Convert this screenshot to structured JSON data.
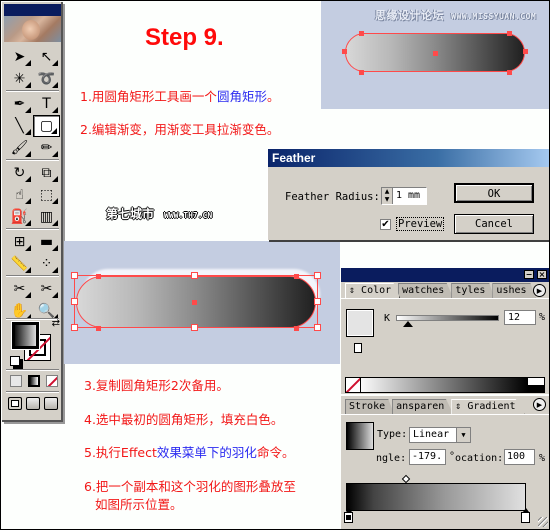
{
  "title": "Step 9.",
  "instructions": {
    "line1": {
      "prefix": "1.用圆角矩形工具画一个",
      "highlight": "圆角矩形",
      "suffix": "。"
    },
    "line2": "2.编辑渐变，用渐变工具拉渐变色。",
    "line3": "3.复制圆角矩形2次备用。",
    "line4": "4.选中最初的圆角矩形，填充白色。",
    "line5": {
      "prefix": "5.执行Effect",
      "highlight1": "效果菜单下的",
      "highlight2": "羽化",
      "suffix": "命令。"
    },
    "line6a": "6.把一个副本和这个羽化的图形叠放至",
    "line6b": "如图所示位置。"
  },
  "watermarks": {
    "missyuan_cn": "思缘设计论坛",
    "missyuan_url": "WWW.MISSYUAN.COM",
    "th7_cn": "第七城市",
    "th7_url": "WWW.TH7.CN"
  },
  "toolbox": {
    "tools": [
      {
        "name": "selection",
        "glyph": "➤"
      },
      {
        "name": "direct-selection",
        "glyph": "↖"
      },
      {
        "name": "magic-wand",
        "glyph": "✳"
      },
      {
        "name": "lasso",
        "glyph": "➰"
      },
      {
        "name": "pen",
        "glyph": "✒"
      },
      {
        "name": "type",
        "glyph": "T"
      },
      {
        "name": "line-segment",
        "glyph": "╲"
      },
      {
        "name": "rounded-rectangle",
        "glyph": "▢",
        "selected": true
      },
      {
        "name": "paintbrush",
        "glyph": "🖌"
      },
      {
        "name": "pencil",
        "glyph": "✏"
      },
      {
        "name": "rotate",
        "glyph": "↻"
      },
      {
        "name": "scale",
        "glyph": "⧉"
      },
      {
        "name": "warp",
        "glyph": "☝"
      },
      {
        "name": "free-transform",
        "glyph": "⬚"
      },
      {
        "name": "symbol-sprayer",
        "glyph": "⛽"
      },
      {
        "name": "column-graph",
        "glyph": "▥"
      },
      {
        "name": "mesh",
        "glyph": "⊞"
      },
      {
        "name": "gradient",
        "glyph": "▬"
      },
      {
        "name": "measure",
        "glyph": "📏"
      },
      {
        "name": "blend",
        "glyph": "⁘"
      },
      {
        "name": "slice",
        "glyph": "✂"
      },
      {
        "name": "scissors",
        "glyph": "✂"
      },
      {
        "name": "hand",
        "glyph": "✋"
      },
      {
        "name": "zoom",
        "glyph": "🔍"
      }
    ],
    "swap_glyph": "⇄"
  },
  "feather_dialog": {
    "title": "Feather",
    "radius_label": "Feather Radius:",
    "radius_value": "1 mm",
    "ok_label": "OK",
    "cancel_label": "Cancel",
    "preview_label": "Preview",
    "preview_checked": true,
    "check_glyph": "✔",
    "spin_up": "▲",
    "spin_down": "▼"
  },
  "color_panel": {
    "tabs": [
      "Color",
      "watches",
      "tyles",
      "ushes"
    ],
    "active_tab": "Color",
    "channel_label": "K",
    "channel_value": "12",
    "channel_fraction": 0.12,
    "percent": "%",
    "menu_glyph": "▶",
    "minimize_glyph": "−",
    "close_glyph": "×"
  },
  "gradient_panel": {
    "tabs": [
      "Stroke",
      "ansparen",
      "Gradient"
    ],
    "active_tab": "Gradient",
    "type_label": "Type:",
    "type_value": "Linear",
    "angle_label": "ngle:",
    "angle_value": "-179.",
    "degree": "°",
    "location_label": "ocation:",
    "location_value": "100",
    "percent": "%",
    "menu_glyph": "▶",
    "dropdown_glyph": "▼"
  }
}
